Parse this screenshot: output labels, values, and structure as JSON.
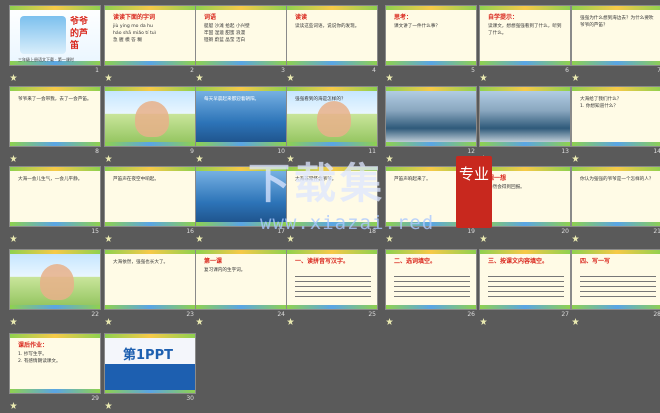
{
  "colors": {
    "background": "#5a5a5a",
    "slide_bg": "#fffbe6",
    "accent_red": "#d9261c",
    "ocean": "#2d74b8",
    "green": "#6bb244"
  },
  "slides": [
    {
      "number": "1",
      "kind": "cover",
      "title": "爷爷的芦笛",
      "note": "三年级上册语文下载 · 第一课时"
    },
    {
      "number": "2",
      "kind": "pinyin",
      "title": "读读下面的字词",
      "text": "jiù   ying   mo   da   hu\nháo  shā   miǎo tí   tuì\n急   腥   模   答   糊"
    },
    {
      "number": "3",
      "kind": "words",
      "title": "词语",
      "text": "艇艇  沙滩  拾起  小兴壁\n牢固  湿漉  甜蜜  浪漫\n铿锵  蔚蓝  晶莹  洁白"
    },
    {
      "number": "4",
      "kind": "text",
      "title": "读读",
      "text": "读读这些词语，说说你的发现。"
    },
    {
      "number": "5",
      "kind": "text",
      "title": "思考：",
      "text": "课文讲了一件什么事？"
    },
    {
      "number": "6",
      "kind": "text",
      "title": "自学提示：",
      "text": "读课文，想想强强看到了什么，听到了什么。"
    },
    {
      "number": "7",
      "kind": "text",
      "title": "",
      "text": "强强为什么想到海边去？为什么要吹爷爷的芦笛？"
    },
    {
      "number": "8",
      "kind": "text",
      "title": "",
      "text": "爷爷来了一会带我，去了一会芦笛。"
    },
    {
      "number": "9",
      "kind": "image",
      "title": "",
      "text": ""
    },
    {
      "number": "10",
      "kind": "ocean",
      "title": "",
      "text": "每天早晨起来都迎着朝阳。"
    },
    {
      "number": "11",
      "kind": "image",
      "title": "",
      "text": "强强看到的海是怎样的？"
    },
    {
      "number": "12",
      "kind": "wave",
      "title": "",
      "text": ""
    },
    {
      "number": "13",
      "kind": "wave",
      "title": "",
      "text": ""
    },
    {
      "number": "14",
      "kind": "text",
      "title": "",
      "text": "大海给了我们什么？\n1. 你想知道什么？"
    },
    {
      "number": "15",
      "kind": "text",
      "title": "",
      "text": "大海一会儿生气，一会儿平静。"
    },
    {
      "number": "16",
      "kind": "text",
      "title": "",
      "text": "芦笛声在夜空中响起。"
    },
    {
      "number": "17",
      "kind": "ocean",
      "title": "",
      "text": ""
    },
    {
      "number": "18",
      "kind": "text",
      "title": "",
      "text": "大海非常怀念爷爷。"
    },
    {
      "number": "19",
      "kind": "text",
      "title": "",
      "text": "芦笛声响起来了。"
    },
    {
      "number": "20",
      "kind": "text",
      "title": "想一想",
      "text": "仍然会得到回报。"
    },
    {
      "number": "21",
      "kind": "text",
      "title": "",
      "text": "你认为强强的爷爷是一个怎样的人？"
    },
    {
      "number": "22",
      "kind": "image",
      "title": "",
      "text": ""
    },
    {
      "number": "23",
      "kind": "text",
      "title": "",
      "text": "大海依然，强强也长大了。"
    },
    {
      "number": "24",
      "kind": "text",
      "title": "第一课",
      "text": "复习课内的生字词。"
    },
    {
      "number": "25",
      "kind": "lines",
      "title": "一、读拼音写汉字。",
      "text": ""
    },
    {
      "number": "26",
      "kind": "lines",
      "title": "二、选词填空。",
      "text": ""
    },
    {
      "number": "27",
      "kind": "lines",
      "title": "三、按课文内容填空。",
      "text": ""
    },
    {
      "number": "28",
      "kind": "lines",
      "title": "四、写一写",
      "text": ""
    },
    {
      "number": "29",
      "kind": "text",
      "title": "课后作业：",
      "text": "1. 抄写生字。\n2. 有感情朗读课文。"
    },
    {
      "number": "30",
      "kind": "brand",
      "title": "第1PPT",
      "text": ""
    }
  ],
  "watermark": {
    "text": "下载集",
    "seal": "专业",
    "url": "www.xiazai.red"
  }
}
